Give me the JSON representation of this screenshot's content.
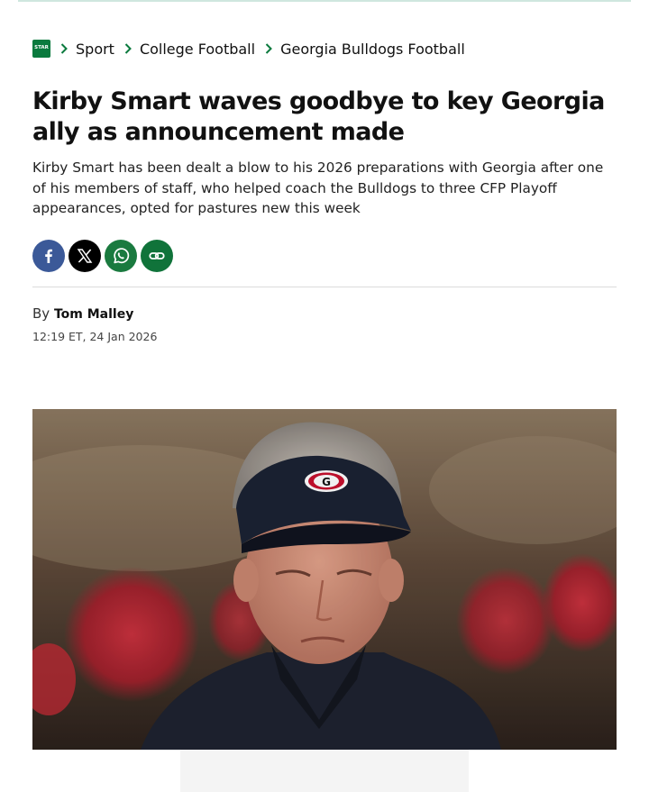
{
  "breadcrumb": {
    "logo_text": "STAR",
    "items": [
      {
        "label": "Sport"
      },
      {
        "label": "College Football"
      },
      {
        "label": "Georgia Bulldogs Football"
      }
    ]
  },
  "article": {
    "headline": "Kirby Smart waves goodbye to key Georgia ally as announcement made",
    "standfirst": "Kirby Smart has been dealt a blow to his 2026 preparations with Georgia after one of his members of staff, who helped coach the Bulldogs to three CFP Playoff appearances, opted for pastures new this week",
    "byline_prefix": "By",
    "author": "Tom Malley",
    "timestamp": "12:19 ET, 24 Jan 2026"
  },
  "share": {
    "buttons": [
      {
        "icon": "facebook-icon",
        "color": "#3b5998"
      },
      {
        "icon": "x-icon",
        "color": "#000000"
      },
      {
        "icon": "whatsapp-icon",
        "color": "#1a7a3f"
      },
      {
        "icon": "link-icon",
        "color": "#10733a"
      }
    ]
  },
  "hero_image": {
    "visor_logo": "G"
  },
  "colors": {
    "brand_green": "#0a7a3e",
    "breadcrumb_chevron": "#0a7a3e"
  }
}
